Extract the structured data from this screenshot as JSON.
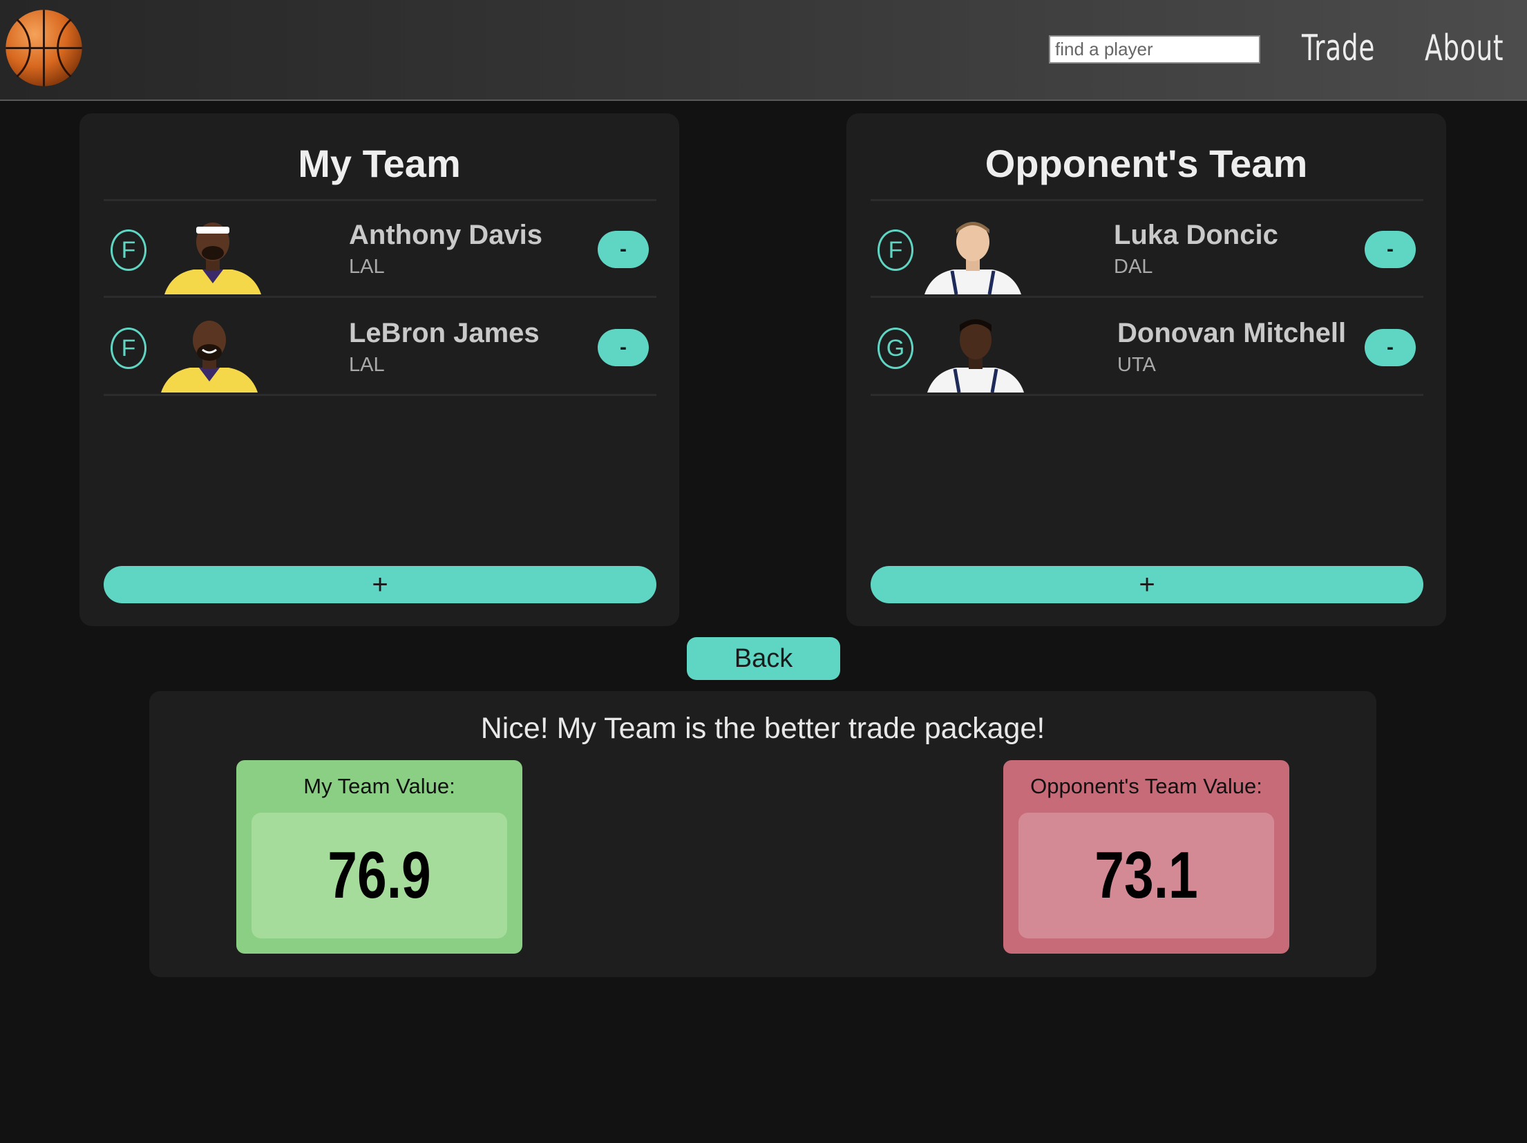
{
  "nav": {
    "search_placeholder": "find a player",
    "trade_label": "Trade",
    "about_label": "About",
    "logo_icon": "basketball-icon"
  },
  "my_team": {
    "title": "My Team",
    "players": [
      {
        "position": "F",
        "name": "Anthony Davis",
        "team": "LAL",
        "remove_label": "-",
        "jersey_color": "#f5d84a"
      },
      {
        "position": "F",
        "name": "LeBron James",
        "team": "LAL",
        "remove_label": "-",
        "jersey_color": "#f5d84a"
      }
    ],
    "add_label": "+"
  },
  "opponent_team": {
    "title": "Opponent's Team",
    "players": [
      {
        "position": "F",
        "name": "Luka Doncic",
        "team": "DAL",
        "remove_label": "-",
        "jersey_color": "#f4f4f4"
      },
      {
        "position": "G",
        "name": "Donovan Mitchell",
        "team": "UTA",
        "remove_label": "-",
        "jersey_color": "#f4f4f4"
      }
    ],
    "add_label": "+"
  },
  "back_label": "Back",
  "result": {
    "message": "Nice! My Team is the better trade package!",
    "my_value_label": "My Team Value:",
    "my_value": "76.9",
    "opp_value_label": "Opponent's Team Value:",
    "opp_value": "73.1"
  },
  "colors": {
    "accent": "#5fd5c3",
    "win_card": "#8bcf84",
    "lose_card": "#c76b78"
  }
}
